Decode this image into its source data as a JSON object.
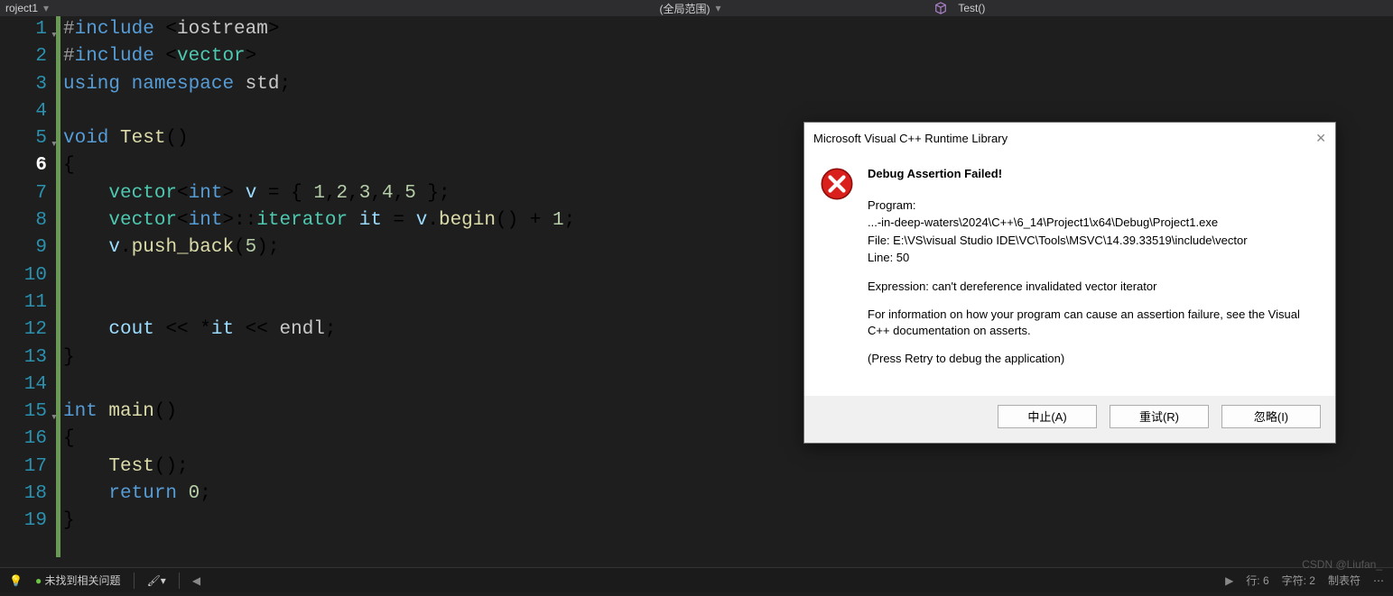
{
  "topbar": {
    "left_dropdown": "roject1",
    "mid_dropdown": "(全局范围)",
    "right_symbol": "Test()"
  },
  "code": {
    "lines": [
      {
        "n": 1,
        "txt": "#include <iostream>",
        "fold": true
      },
      {
        "n": 2,
        "txt": "#include <vector>"
      },
      {
        "n": 3,
        "txt": "using namespace std;"
      },
      {
        "n": 4,
        "txt": ""
      },
      {
        "n": 5,
        "txt": "void Test()",
        "fold": true
      },
      {
        "n": 6,
        "txt": "{",
        "current": true
      },
      {
        "n": 7,
        "txt": "    vector<int> v = { 1,2,3,4,5 };"
      },
      {
        "n": 8,
        "txt": "    vector<int>::iterator it = v.begin() + 1;"
      },
      {
        "n": 9,
        "txt": "    v.push_back(5);"
      },
      {
        "n": 10,
        "txt": ""
      },
      {
        "n": 11,
        "txt": ""
      },
      {
        "n": 12,
        "txt": "    cout << *it << endl;"
      },
      {
        "n": 13,
        "txt": "}"
      },
      {
        "n": 14,
        "txt": ""
      },
      {
        "n": 15,
        "txt": "int main()",
        "fold": true
      },
      {
        "n": 16,
        "txt": "{"
      },
      {
        "n": 17,
        "txt": "    Test();"
      },
      {
        "n": 18,
        "txt": "    return 0;"
      },
      {
        "n": 19,
        "txt": "}"
      }
    ]
  },
  "dialog": {
    "title": "Microsoft Visual C++ Runtime Library",
    "heading": "Debug Assertion Failed!",
    "program_label": "Program:",
    "program_path": "...-in-deep-waters\\2024\\C++\\6_14\\Project1\\x64\\Debug\\Project1.exe",
    "file_line": "File: E:\\VS\\visual Studio IDE\\VC\\Tools\\MSVC\\14.39.33519\\include\\vector",
    "line_line": "Line: 50",
    "expression": "Expression: can't dereference invalidated vector iterator",
    "info1": "For information on how your program can cause an assertion failure, see the Visual C++ documentation on asserts.",
    "info2": "(Press Retry to debug the application)",
    "buttons": {
      "abort": "中止(A)",
      "retry": "重试(R)",
      "ignore": "忽略(I)"
    }
  },
  "status": {
    "issues": "未找到相关问题",
    "line_label": "行: 6",
    "col_label": "字符: 2",
    "tabs_label": "制表符"
  },
  "watermark": "CSDN @Liufan_"
}
